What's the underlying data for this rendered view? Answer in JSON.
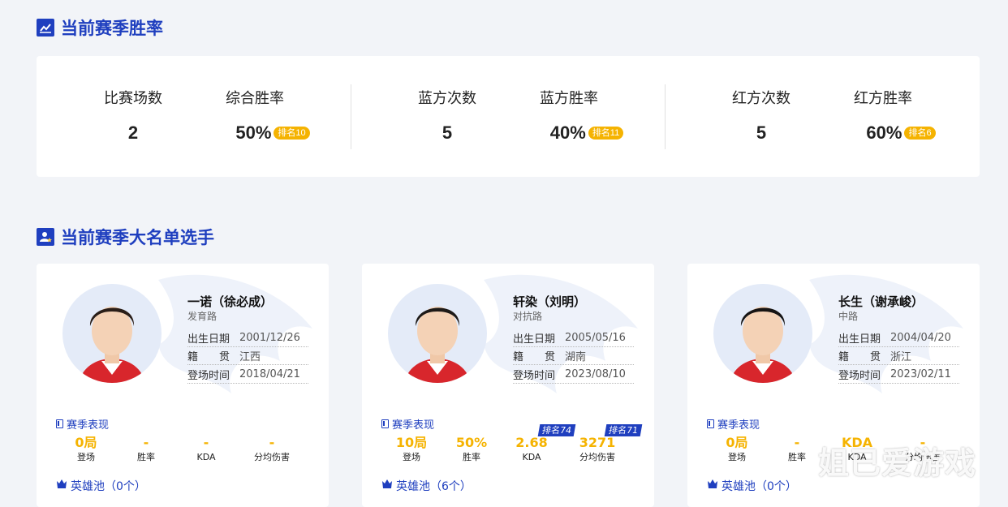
{
  "season_winrate": {
    "title": "当前赛季胜率",
    "groups": [
      {
        "a_label": "比赛场数",
        "a_value": "2",
        "b_label": "综合胜率",
        "b_value": "50%",
        "b_rank": "排名10"
      },
      {
        "a_label": "蓝方次数",
        "a_value": "5",
        "b_label": "蓝方胜率",
        "b_value": "40%",
        "b_rank": "排名11"
      },
      {
        "a_label": "红方次数",
        "a_value": "5",
        "b_label": "红方胜率",
        "b_value": "60%",
        "b_rank": "排名6"
      }
    ]
  },
  "roster": {
    "title": "当前赛季大名单选手",
    "info_labels": {
      "birth": "出生日期",
      "origin": "籍　　贯",
      "debut": "登场时间"
    },
    "perf_title": "赛季表现",
    "metric_labels": [
      "登场",
      "胜率",
      "KDA",
      "分均伤害"
    ],
    "players": [
      {
        "name": "一诺（徐必成）",
        "position": "发育路",
        "birth": "2001/12/26",
        "origin": "江西",
        "debut": "2018/04/21",
        "metrics": [
          "0局",
          "-",
          "-",
          "-"
        ],
        "ranks": [
          "",
          ""
        ],
        "pool": "英雄池（0个）"
      },
      {
        "name": "轩染（刘明）",
        "position": "对抗路",
        "birth": "2005/05/16",
        "origin": "湖南",
        "debut": "2023/08/10",
        "metrics": [
          "10局",
          "50%",
          "2.68",
          "3271"
        ],
        "ranks": [
          "排名74",
          "排名71"
        ],
        "pool": "英雄池（6个）"
      },
      {
        "name": "长生（谢承峻）",
        "position": "中路",
        "birth": "2004/04/20",
        "origin": "浙江",
        "debut": "2023/02/11",
        "metrics": [
          "0局",
          "-",
          "KDA",
          "-"
        ],
        "ranks": [
          "",
          ""
        ],
        "pool": "英雄池（0个）"
      }
    ]
  },
  "watermark": "姐已爱游戏",
  "colors": {
    "accent": "#1f3fbf",
    "highlight": "#f5b301",
    "background": "#f2f4f8"
  }
}
